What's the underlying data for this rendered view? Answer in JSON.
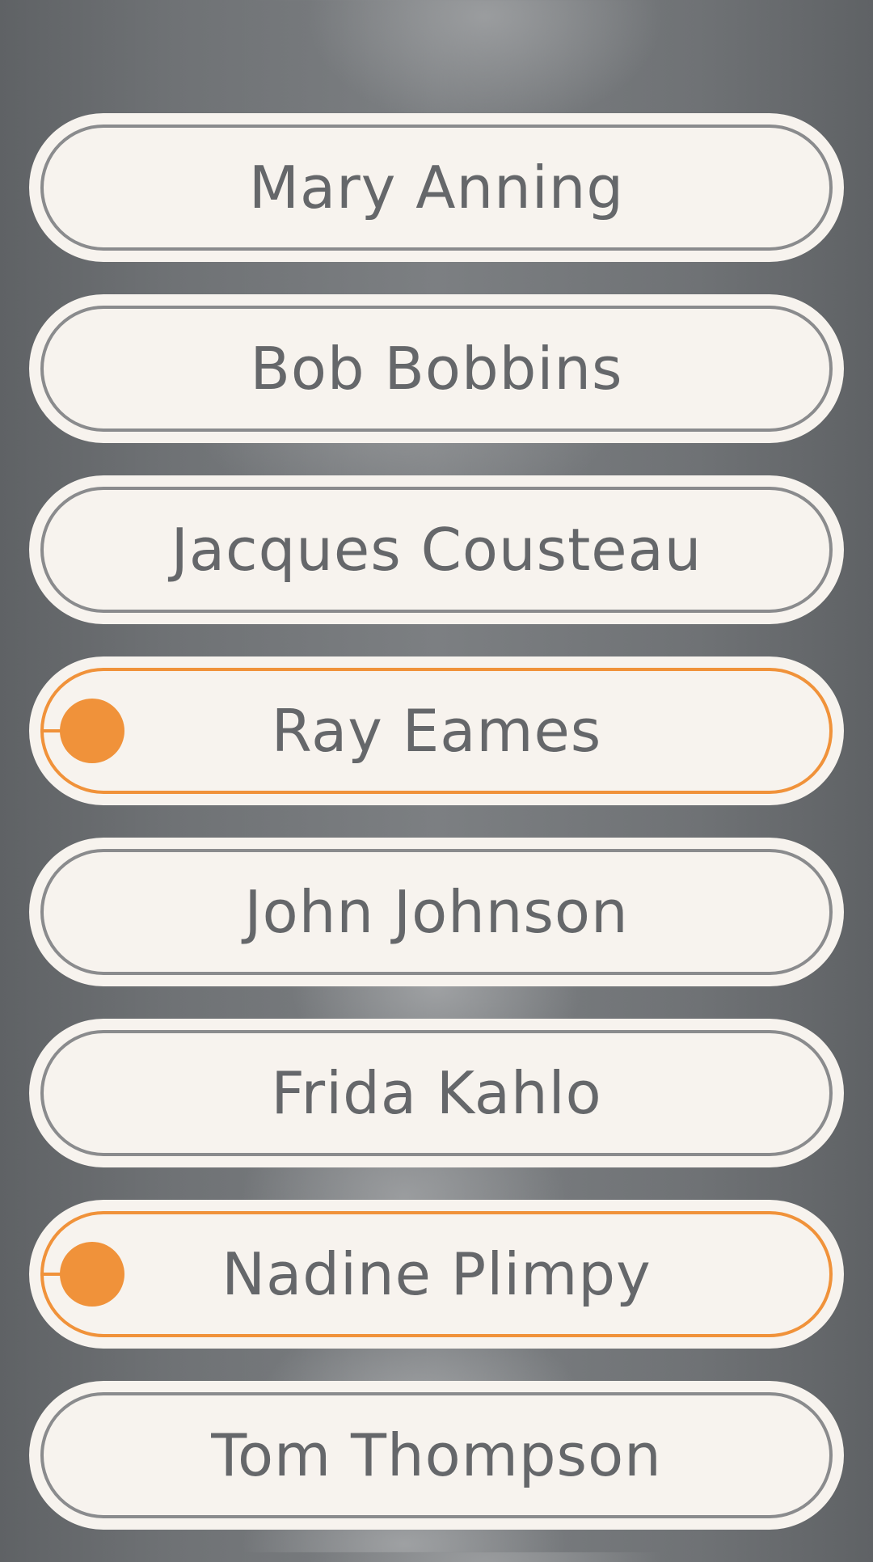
{
  "colors": {
    "accent": "#f0923a",
    "pill_background": "#f7f3ee",
    "pill_border": "#8a8b8d",
    "text": "#65676a"
  },
  "people": [
    {
      "name": "Mary Anning",
      "selected": false
    },
    {
      "name": "Bob Bobbins",
      "selected": false
    },
    {
      "name": "Jacques Cousteau",
      "selected": false
    },
    {
      "name": "Ray Eames",
      "selected": true
    },
    {
      "name": "John Johnson",
      "selected": false
    },
    {
      "name": "Frida Kahlo",
      "selected": false
    },
    {
      "name": "Nadine Plimpy",
      "selected": true
    },
    {
      "name": "Tom Thompson",
      "selected": false
    }
  ]
}
